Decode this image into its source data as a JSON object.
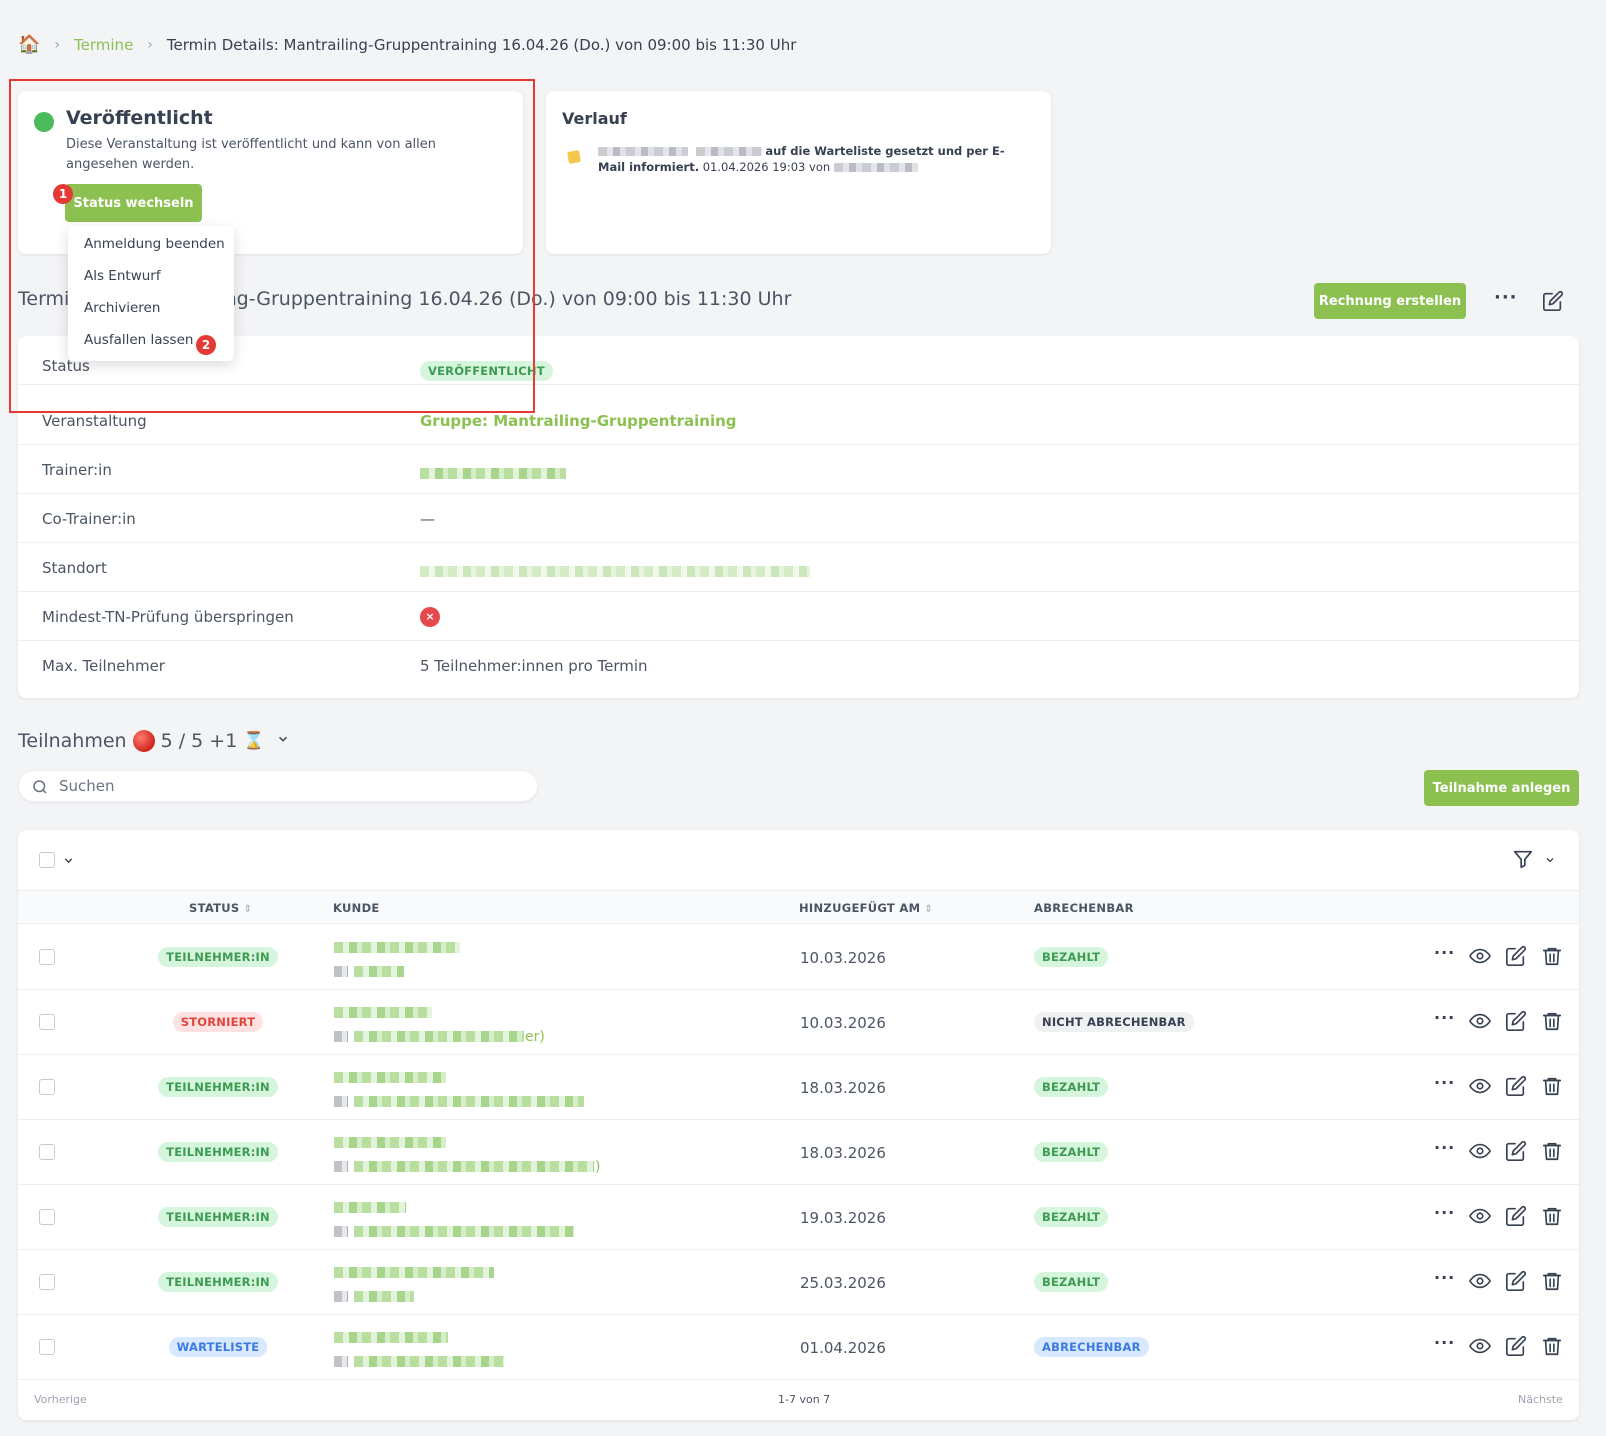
{
  "breadcrumb": {
    "home_icon": "home-icon",
    "link": "Termine",
    "current": "Termin Details: Mantrailing-Gruppentraining 16.04.26 (Do.) von 09:00 bis 11:30 Uhr"
  },
  "status_card": {
    "title": "Veröffentlicht",
    "description": "Diese Veranstaltung ist veröffentlicht und kann von allen angesehen werden.",
    "button": "Status wechseln",
    "marker1": "1",
    "marker2": "2",
    "dropdown": [
      "Anmeldung beenden",
      "Als Entwurf",
      "Archivieren",
      "Ausfallen lassen"
    ]
  },
  "verlauf": {
    "title": "Verlauf",
    "text_bold": "auf die Warteliste gesetzt und per E-Mail informiert.",
    "text_rest": "01.04.2026 19:03 von"
  },
  "section": {
    "title_prefix": "Termi",
    "title_suffix": "ing-Gruppentraining 16.04.26 (Do.) von 09:00 bis 11:30 Uhr",
    "rechnung_button": "Rechnung erstellen",
    "more": "···"
  },
  "details": {
    "status_label": "Status",
    "status_badge": "VERÖFFENTLICHT",
    "veranstaltung_label": "Veranstaltung",
    "veranstaltung_value": "Gruppe: Mantrailing-Gruppentraining",
    "trainer_label": "Trainer:in",
    "cotrainer_label": "Co-Trainer:in",
    "cotrainer_value": "—",
    "standort_label": "Standort",
    "mindest_label": "Mindest-TN-Prüfung überspringen",
    "mindest_value": "×",
    "max_label": "Max. Teilnehmer",
    "max_value": "5 Teilnehmer:innen pro Termin"
  },
  "teilnahmen": {
    "title": "Teilnahmen",
    "count": "5 / 5 +1",
    "hourglass": "⌛",
    "chevron": "⌄",
    "search_placeholder": "Suchen",
    "create_button": "Teilnahme anlegen"
  },
  "table": {
    "headers": {
      "status": "STATUS",
      "kunde": "KUNDE",
      "added": "HINZUGEFÜGT AM",
      "abrechenbar": "ABRECHENBAR"
    },
    "rows": [
      {
        "status": "TEILNEHMER:IN",
        "status_color": "green",
        "date": "10.03.2026",
        "abr": "BEZAHLT",
        "abr_color": "green"
      },
      {
        "status": "STORNIERT",
        "status_color": "red",
        "date": "10.03.2026",
        "abr": "NICHT ABRECHENBAR",
        "abr_color": "gray",
        "tail": "er)"
      },
      {
        "status": "TEILNEHMER:IN",
        "status_color": "green",
        "date": "18.03.2026",
        "abr": "BEZAHLT",
        "abr_color": "green"
      },
      {
        "status": "TEILNEHMER:IN",
        "status_color": "green",
        "date": "18.03.2026",
        "abr": "BEZAHLT",
        "abr_color": "green",
        "tail": ")"
      },
      {
        "status": "TEILNEHMER:IN",
        "status_color": "green",
        "date": "19.03.2026",
        "abr": "BEZAHLT",
        "abr_color": "green"
      },
      {
        "status": "TEILNEHMER:IN",
        "status_color": "green",
        "date": "25.03.2026",
        "abr": "BEZAHLT",
        "abr_color": "green"
      },
      {
        "status": "WARTELISTE",
        "status_color": "blue",
        "date": "01.04.2026",
        "abr": "ABRECHENBAR",
        "abr_color": "blue"
      }
    ],
    "pager": {
      "prev": "Vorherige",
      "info": "1-7 von 7",
      "next": "Nächste"
    }
  },
  "colors": {
    "accent": "#8cc152",
    "published": "#4cbb5c",
    "highlight": "#e53935"
  }
}
